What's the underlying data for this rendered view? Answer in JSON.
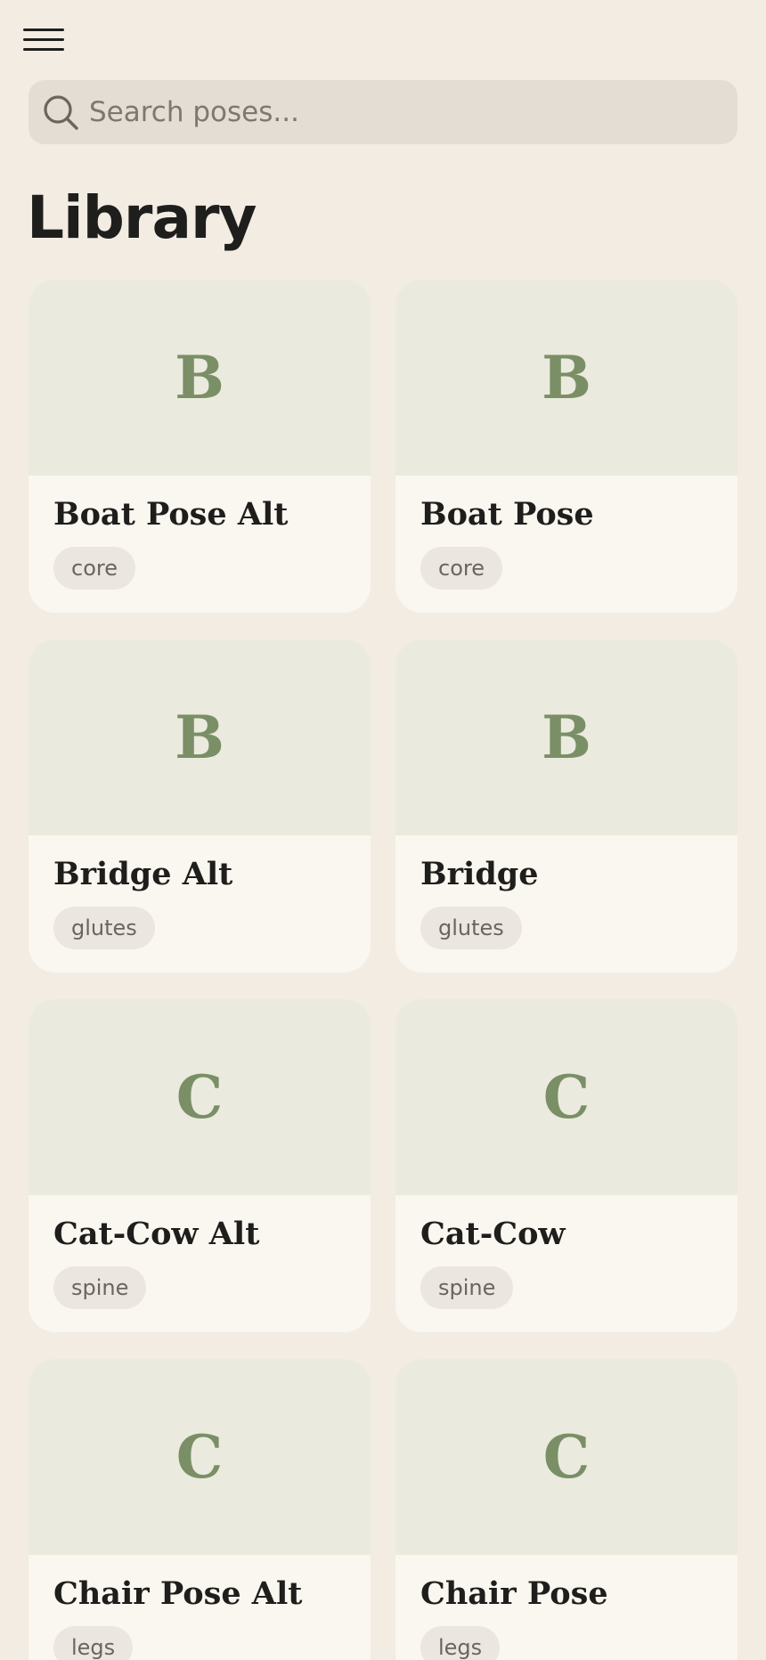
{
  "header": {
    "menu_icon": "hamburger-menu-icon"
  },
  "search": {
    "placeholder": "Search poses...",
    "value": "",
    "icon": "search-icon"
  },
  "page": {
    "title": "Library"
  },
  "colors": {
    "background": "#f2ece3",
    "card_thumb": "#ebeade",
    "card_body": "#faf6f0",
    "letter": "#7a8f66",
    "tag_bg": "#ebe7e0"
  },
  "poses": [
    {
      "letter": "B",
      "name": "Boat Pose Alt",
      "tag": "core"
    },
    {
      "letter": "B",
      "name": "Boat Pose",
      "tag": "core"
    },
    {
      "letter": "B",
      "name": "Bridge Alt",
      "tag": "glutes"
    },
    {
      "letter": "B",
      "name": "Bridge",
      "tag": "glutes"
    },
    {
      "letter": "C",
      "name": "Cat-Cow Alt",
      "tag": "spine"
    },
    {
      "letter": "C",
      "name": "Cat-Cow",
      "tag": "spine"
    },
    {
      "letter": "C",
      "name": "Chair Pose Alt",
      "tag": "legs"
    },
    {
      "letter": "C",
      "name": "Chair Pose",
      "tag": "legs"
    }
  ]
}
